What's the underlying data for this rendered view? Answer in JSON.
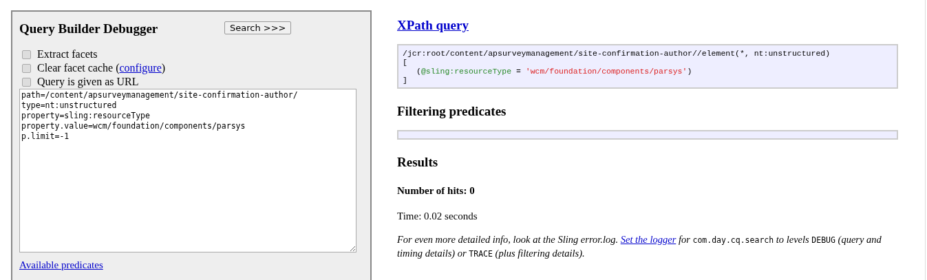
{
  "debugger": {
    "title": "Query Builder Debugger",
    "search_button": "Search >>>",
    "options": [
      {
        "parts": [
          {
            "kind": "text",
            "text": "Extract facets"
          }
        ],
        "checked": false
      },
      {
        "parts": [
          {
            "kind": "text",
            "text": "Clear facet cache ("
          },
          {
            "kind": "link",
            "text": "configure"
          },
          {
            "kind": "text",
            "text": ")"
          }
        ],
        "checked": false
      },
      {
        "parts": [
          {
            "kind": "text",
            "text": "Query is given as URL"
          }
        ],
        "checked": false
      }
    ],
    "query": "path=/content/apsurveymanagement/site-confirmation-author/\ntype=nt:unstructured\nproperty=sling:resourceType\nproperty.value=wcm/foundation/components/parsys\np.limit=-1",
    "predicates_link": "Available predicates"
  },
  "xpath": {
    "heading": "XPath query",
    "lines": [
      [
        {
          "kind": "plain",
          "text": "/jcr:root/content/apsurveymanagement/site-confirmation-author//element(*, nt:unstructured)"
        }
      ],
      [
        {
          "kind": "plain",
          "text": "["
        }
      ],
      [
        {
          "kind": "indent",
          "text": "("
        },
        {
          "kind": "attribute",
          "text": "@sling:resourceType"
        },
        {
          "kind": "plain",
          "text": " = "
        },
        {
          "kind": "string",
          "text": "'wcm/foundation/components/parsys'"
        },
        {
          "kind": "plain",
          "text": ")"
        }
      ],
      [
        {
          "kind": "plain",
          "text": "]"
        }
      ]
    ]
  },
  "filtering": {
    "heading": "Filtering predicates"
  },
  "results": {
    "heading": "Results",
    "hits": "Number of hits: 0",
    "time": "Time: 0.02 seconds",
    "info": [
      {
        "kind": "text",
        "text": "For even more detailed info, look at the Sling error.log. "
      },
      {
        "kind": "link",
        "text": "Set the logger"
      },
      {
        "kind": "text",
        "text": " for "
      },
      {
        "kind": "code",
        "text": "com.day.cq.search"
      },
      {
        "kind": "text",
        "text": " to levels "
      },
      {
        "kind": "code",
        "text": "DEBUG"
      },
      {
        "kind": "text",
        "text": " (query and timing details) or "
      },
      {
        "kind": "code",
        "text": "TRACE"
      },
      {
        "kind": "text",
        "text": " (plus filtering details)."
      }
    ]
  }
}
